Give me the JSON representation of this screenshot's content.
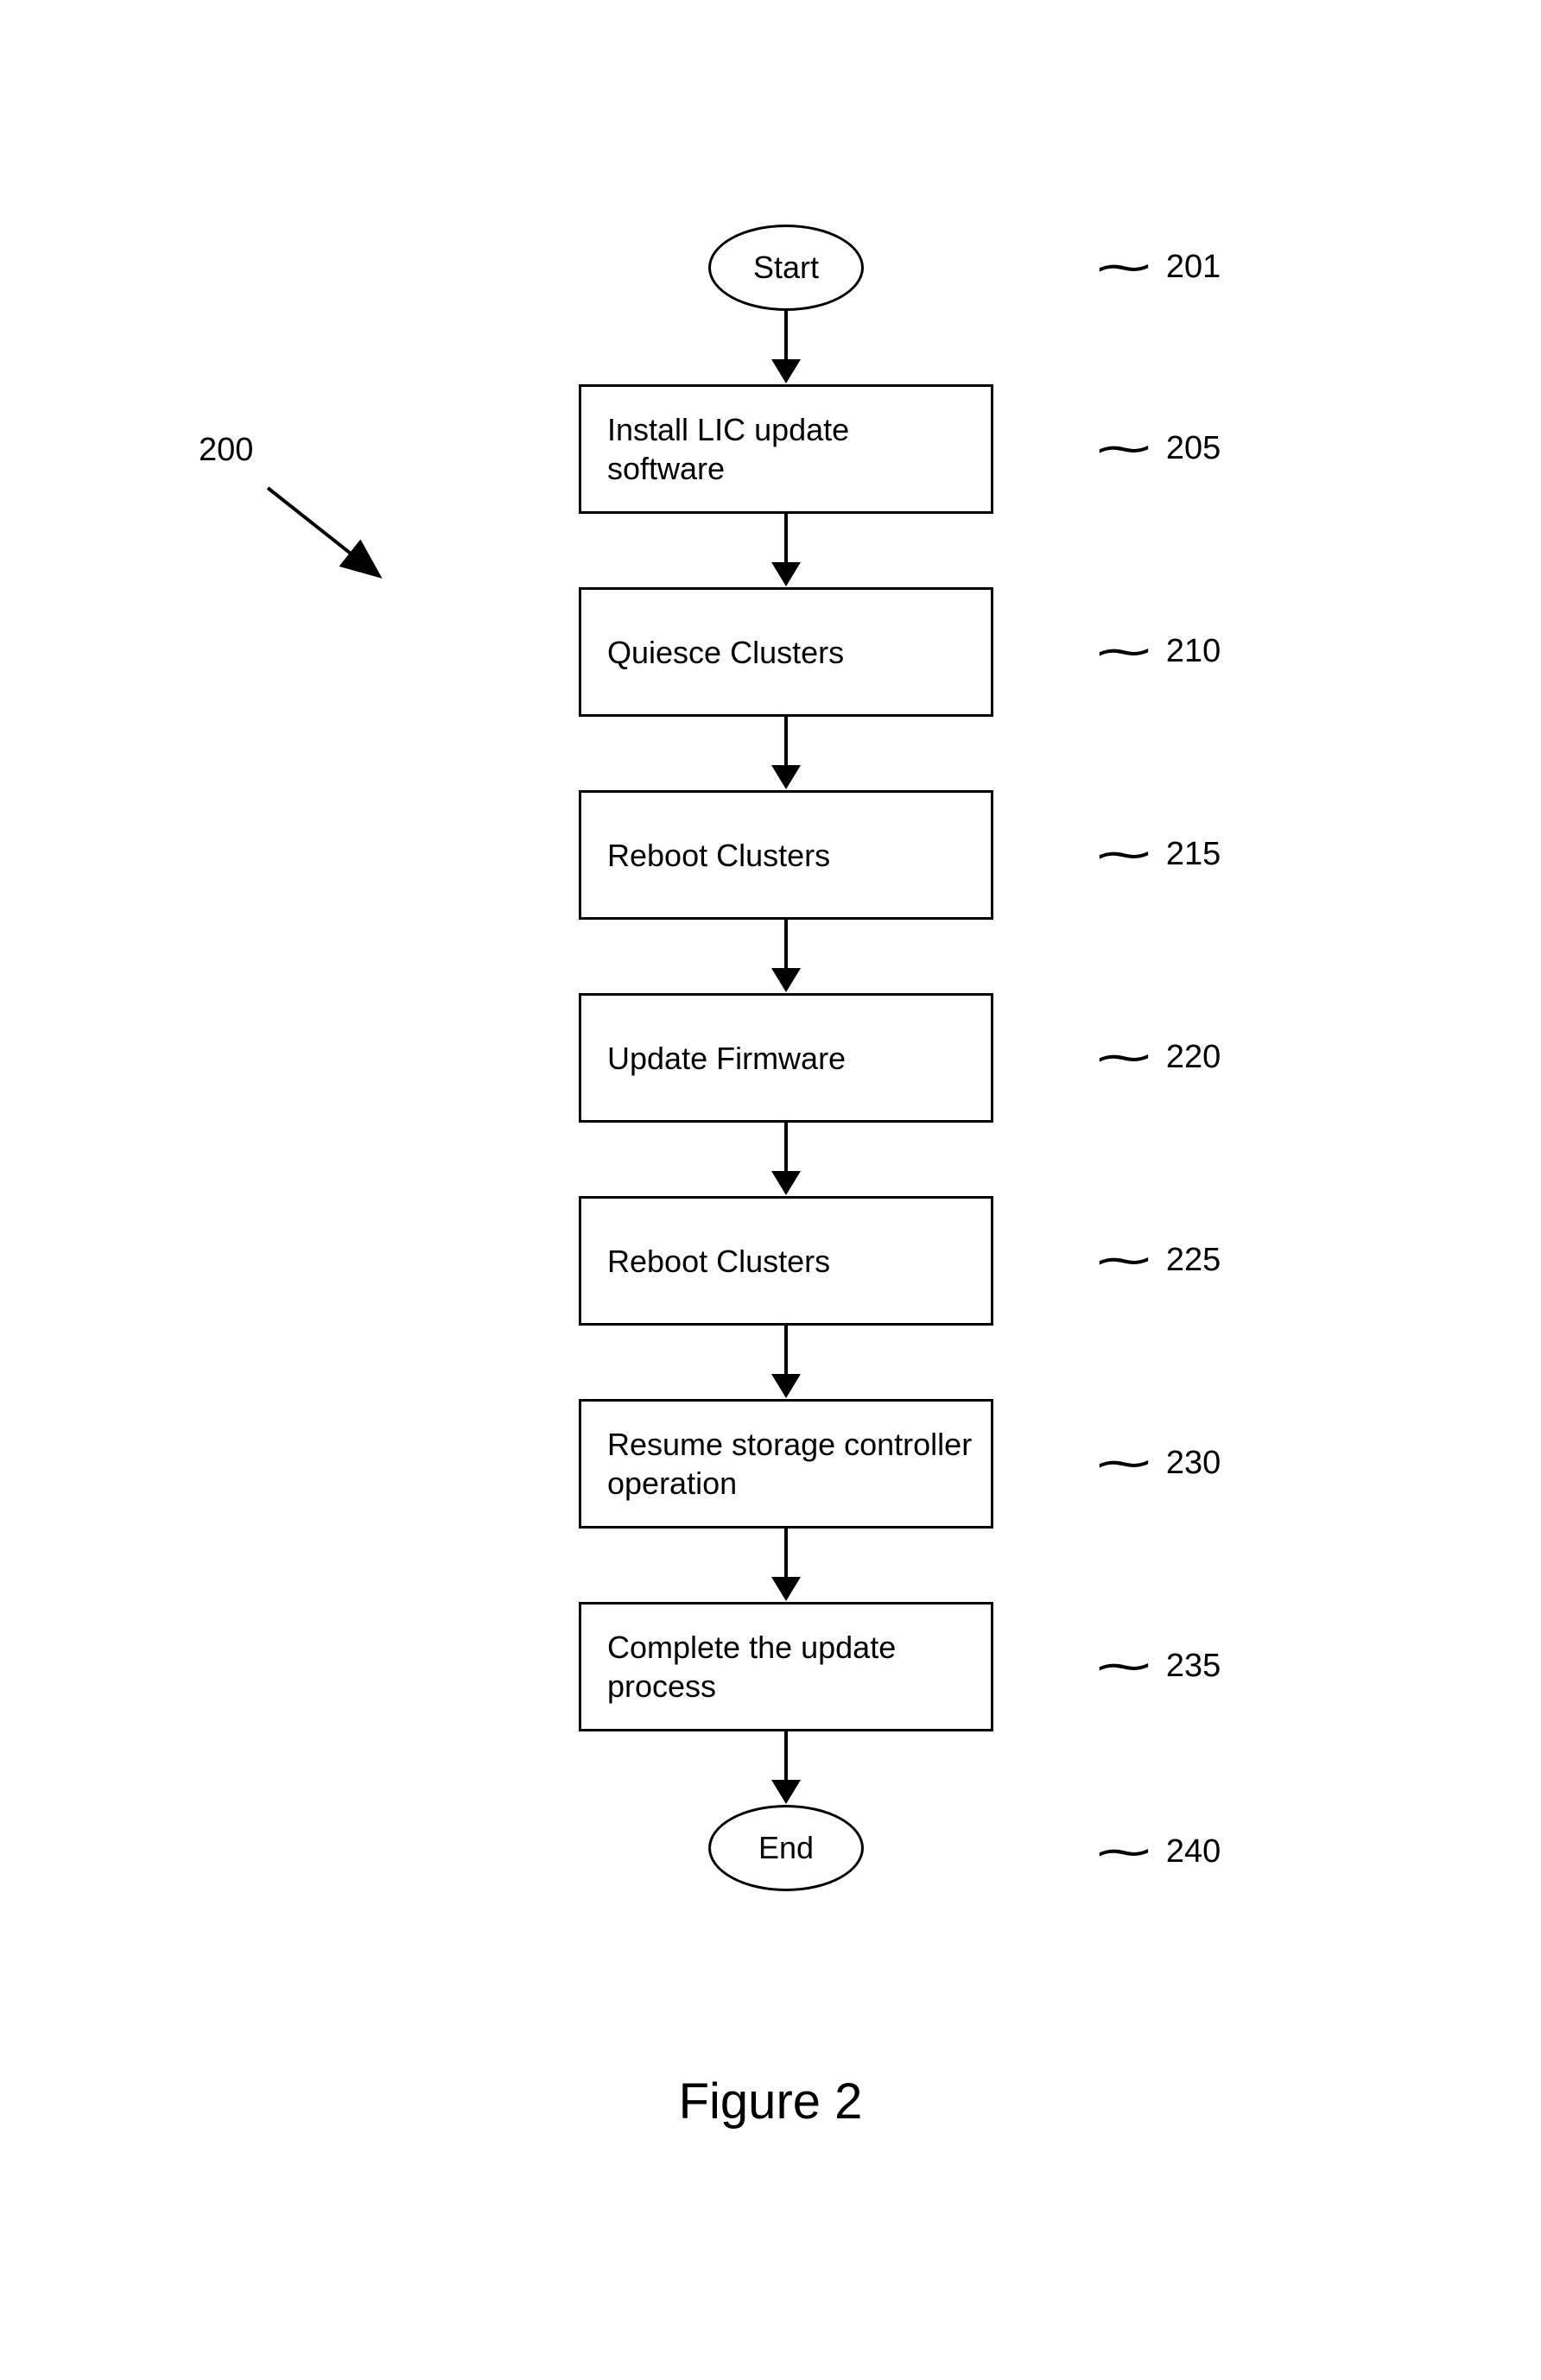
{
  "flowchart": {
    "diagram_ref": "200",
    "caption": "Figure 2",
    "nodes": [
      {
        "id": "start",
        "type": "terminator",
        "label": "Start",
        "ref": "201"
      },
      {
        "id": "install",
        "type": "process",
        "label": "Install LIC update software",
        "ref": "205"
      },
      {
        "id": "quiesce",
        "type": "process",
        "label": "Quiesce Clusters",
        "ref": "210"
      },
      {
        "id": "reboot1",
        "type": "process",
        "label": "Reboot Clusters",
        "ref": "215"
      },
      {
        "id": "firmware",
        "type": "process",
        "label": "Update Firmware",
        "ref": "220"
      },
      {
        "id": "reboot2",
        "type": "process",
        "label": "Reboot Clusters",
        "ref": "225"
      },
      {
        "id": "resume",
        "type": "process",
        "label": "Resume storage controller operation",
        "ref": "230"
      },
      {
        "id": "complete",
        "type": "process",
        "label": "Complete the update process",
        "ref": "235"
      },
      {
        "id": "end",
        "type": "terminator",
        "label": "End",
        "ref": "240"
      }
    ]
  }
}
